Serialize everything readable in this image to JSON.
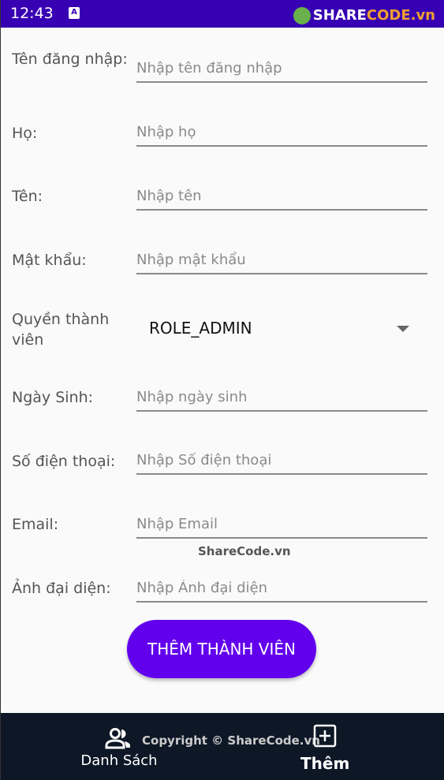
{
  "status_bar": {
    "time": "12:43",
    "notification_icon": "A",
    "watermark_share": "SHARE",
    "watermark_code": "CODE.vn"
  },
  "form": {
    "fields": [
      {
        "label": "Tên đăng nhập:",
        "placeholder": "Nhập tên đăng nhập"
      },
      {
        "label": "Họ:",
        "placeholder": "Nhập họ"
      },
      {
        "label": "Tên:",
        "placeholder": "Nhập tên"
      },
      {
        "label": "Mật khẩu:",
        "placeholder": "Nhập mật khẩu"
      },
      {
        "label": "Quyền thành viên",
        "value": "ROLE_ADMIN"
      },
      {
        "label": "Ngày Sinh:",
        "placeholder": "Nhập ngày sinh"
      },
      {
        "label": "Số điện thoại:",
        "placeholder": "Nhập Số điện thoại"
      },
      {
        "label": "Email:",
        "placeholder": "Nhập Email"
      },
      {
        "label": "Ảnh đại diện:",
        "placeholder": "Nhập Ảnh đại diện"
      }
    ],
    "submit_label": "THÊM THÀNH VIÊN"
  },
  "watermark": "ShareCode.vn",
  "bottom_nav": {
    "items": [
      {
        "label": "Danh Sách",
        "icon": "people-icon"
      },
      {
        "label": "Thêm",
        "icon": "add-box-icon",
        "active": true
      }
    ],
    "copyright": "Copyright © ShareCode.vn"
  }
}
